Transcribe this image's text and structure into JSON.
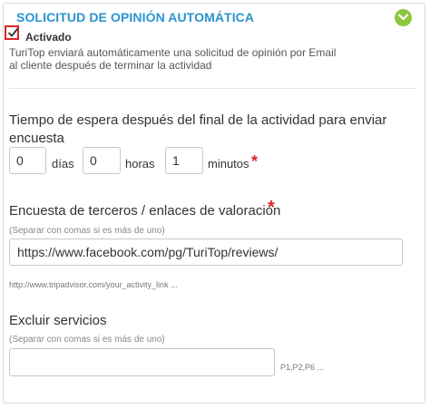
{
  "panel": {
    "title": "SOLICITUD DE OPINIÓN AUTOMÁTICA",
    "accent_color": "#2a93cf",
    "collapse_icon": "chevron-down-icon",
    "collapse_icon_color": "#8cc63f"
  },
  "activated": {
    "checked": true,
    "label": "Activado",
    "description_line1": "TuriTop enviará automáticamente una solicitud de opinión por Email",
    "description_line2": "al cliente después de terminar la actividad"
  },
  "wait_time": {
    "label": "Tiempo de espera después del final de la actividad para enviar encuesta",
    "days_value": "0",
    "days_label": "días",
    "hours_value": "0",
    "hours_label": "horas",
    "minutes_value": "1",
    "minutes_label": "minutos",
    "required_mark": "*"
  },
  "survey_links": {
    "label": "Encuesta de terceros / enlaces de valoración",
    "required_mark": "*",
    "hint": "(Separar con comas si es más de uno)",
    "value": "https://www.facebook.com/pg/TuriTop/reviews/",
    "example": "http://www.tripadvisor.com/your_activity_link ..."
  },
  "exclude_services": {
    "label": "Excluir servicios",
    "hint": "(Separar con comas si es más de uno)",
    "value": "",
    "example": "P1,P2,P6 ..."
  }
}
